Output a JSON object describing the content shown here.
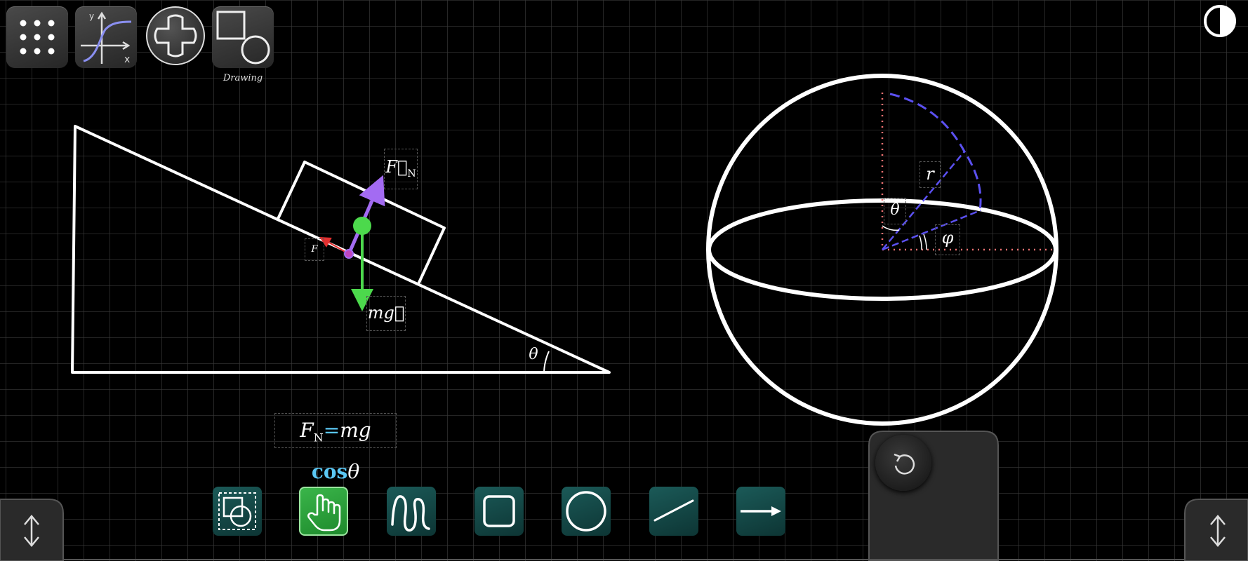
{
  "toolbar": {
    "apps_icon": "grid-dots-icon",
    "graph_icon": "function-graph-icon",
    "dpad_icon": "dpad-icon",
    "drawing_icon": "shapes-icon",
    "drawing_label": "Drawing"
  },
  "theme_icon": "contrast-icon",
  "incline": {
    "normal_force_label": "F⃗",
    "normal_force_sub": "N",
    "friction_label": "F",
    "weight_label": "mg⃗",
    "angle_label": "θ",
    "formula": {
      "lhs": "F",
      "lhs_sub": "N",
      "eq": "=",
      "mg": "mg",
      "cos": "cos",
      "theta": "θ"
    }
  },
  "sphere": {
    "r_label": "r",
    "theta_label": "θ",
    "phi_label": "φ"
  },
  "tools": [
    {
      "name": "select-tool",
      "icon": "selection-icon"
    },
    {
      "name": "hand-tool",
      "icon": "hand-icon",
      "active": true
    },
    {
      "name": "freehand-tool",
      "icon": "freehand-icon"
    },
    {
      "name": "rectangle-tool",
      "icon": "rectangle-icon"
    },
    {
      "name": "circle-tool",
      "icon": "circle-icon"
    },
    {
      "name": "line-tool",
      "icon": "line-icon"
    },
    {
      "name": "arrow-tool",
      "icon": "arrow-icon"
    }
  ],
  "panel": {
    "undo_icon": "undo-icon"
  },
  "colors": {
    "background": "#000000",
    "grid": "#3a3a3a",
    "normal_force": "#a36bf2",
    "weight": "#4cd94c",
    "friction": "#e53030",
    "dashed_purple": "#5b50f0",
    "dotted_red": "#f07070",
    "formula_accent": "#5bc8f5"
  }
}
